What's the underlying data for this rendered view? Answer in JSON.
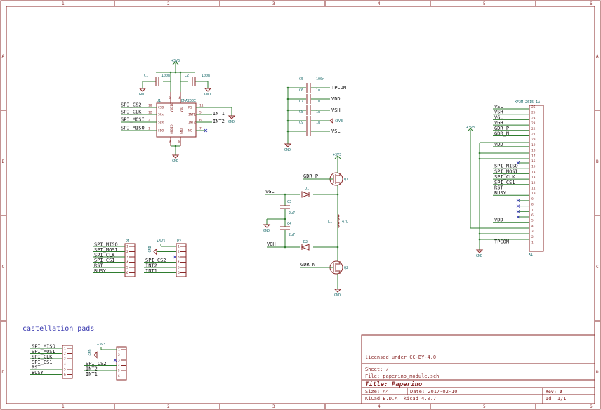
{
  "frame": {
    "cols": [
      "1",
      "2",
      "3",
      "4",
      "5",
      "6"
    ],
    "rows": [
      "A",
      "B",
      "C",
      "D"
    ]
  },
  "title_block": {
    "license": "licensed under CC-BY-4.0",
    "sheet": "Sheet: /",
    "file": "File: paperino_module.sch",
    "title": "Title: Paperino",
    "size": "Size: A4",
    "date": "Date: 2017-02-10",
    "rev": "Rev: 0",
    "tool": "KiCad E.D.A.  kicad 4.0.7",
    "id": "Id: 1/1"
  },
  "note": "castellation pads",
  "power": {
    "v33": "+3V3",
    "gnd": "GND"
  },
  "accel": {
    "ref": "U1",
    "value": "BMA250E",
    "left_pins": [
      {
        "net": "SPI_CS2",
        "num": "10",
        "name": "CSB"
      },
      {
        "net": "SPI_CLK",
        "num": "12",
        "name": "SCx"
      },
      {
        "net": "SPI_MOSI",
        "num": "2",
        "name": "SDx"
      },
      {
        "net": "SPI_MISO",
        "num": "1",
        "name": "SDO"
      }
    ],
    "right_pins": [
      {
        "net": "",
        "num": "11",
        "name": "PS"
      },
      {
        "net": "INT1",
        "num": "5",
        "name": "INT1"
      },
      {
        "net": "INT2",
        "num": "6",
        "name": "INT2"
      },
      {
        "net": "",
        "num": "7",
        "name": "NC"
      }
    ],
    "top_pins": [
      {
        "num": "3",
        "name": "VDDIO"
      },
      {
        "num": "4",
        "name": "VDD"
      }
    ],
    "bottom_pins": [
      {
        "num": "9",
        "name": "GNDIO"
      },
      {
        "num": "8",
        "name": "GND"
      }
    ],
    "caps": [
      {
        "ref": "C1",
        "val": "100n"
      },
      {
        "ref": "C2",
        "val": "100n"
      }
    ]
  },
  "cap_bank": [
    {
      "ref": "C5",
      "val": "100n",
      "net": "TPCOM"
    },
    {
      "ref": "C6",
      "val": "1u",
      "net": "VDD"
    },
    {
      "ref": "C7",
      "val": "1u",
      "net": "VSH"
    },
    {
      "ref": "C8",
      "val": "1u",
      "net": "+3V3"
    },
    {
      "ref": "C9",
      "val": "1u",
      "net": "VSL"
    }
  ],
  "boost": {
    "q1": "Q1",
    "q2": "Q2",
    "gdr_p": "GDR_P",
    "gdr_n": "GDR_N",
    "vgl": "VGL",
    "vgh": "VGH",
    "d1": "D1",
    "d2": "D2",
    "c3": {
      "ref": "C3",
      "val": "2u7"
    },
    "c4": {
      "ref": "C4",
      "val": "2u7"
    },
    "l1": {
      "ref": "L1",
      "val": "47u"
    }
  },
  "fpc": {
    "ref": "X1",
    "value": "XF2M-2615-1A",
    "pins": [
      {
        "num": "26",
        "net": "VSL"
      },
      {
        "num": "25",
        "net": "VSH"
      },
      {
        "num": "24",
        "net": "VGL"
      },
      {
        "num": "23",
        "net": "VGH"
      },
      {
        "num": "22",
        "net": "GDR_P"
      },
      {
        "num": "21",
        "net": "GDR_N"
      },
      {
        "num": "20",
        "net": ""
      },
      {
        "num": "19",
        "net": "VDD"
      },
      {
        "num": "18",
        "net": ""
      },
      {
        "num": "17",
        "net": ""
      },
      {
        "num": "16",
        "net": ""
      },
      {
        "num": "15",
        "net": "SPI_MISO"
      },
      {
        "num": "14",
        "net": "SPI_MOSI"
      },
      {
        "num": "13",
        "net": "SPI_CLK"
      },
      {
        "num": "12",
        "net": "SPI_CS1"
      },
      {
        "num": "11",
        "net": "RST"
      },
      {
        "num": "10",
        "net": "BUSY"
      },
      {
        "num": "9",
        "net": ""
      },
      {
        "num": "8",
        "net": ""
      },
      {
        "num": "7",
        "net": ""
      },
      {
        "num": "6",
        "net": ""
      },
      {
        "num": "5",
        "net": "VDD"
      },
      {
        "num": "4",
        "net": ""
      },
      {
        "num": "3",
        "net": ""
      },
      {
        "num": "2",
        "net": ""
      },
      {
        "num": "1",
        "net": "TPCOM"
      }
    ]
  },
  "headers": {
    "p1": {
      "ref": "P1",
      "nets": [
        "SPI_MISO",
        "SPI_MOSI",
        "SPI_CLK",
        "SPI_CS1",
        "RST",
        "BUSY"
      ],
      "nums": [
        "1",
        "2",
        "3",
        "4",
        "5",
        "6"
      ]
    },
    "p2": {
      "ref": "P2",
      "nets": [
        "",
        "",
        "",
        "SPI_CS2",
        "INT2",
        "INT1"
      ],
      "nums": [
        "1",
        "2",
        "3",
        "4",
        "5",
        "6"
      ]
    },
    "cast_left": {
      "nets": [
        "SPI_MISO",
        "SPI_MOSI",
        "SPI_CLK",
        "SPI_CS1",
        "RST",
        "BUSY"
      ],
      "nums": [
        "1",
        "2",
        "3",
        "4",
        "5",
        "6"
      ]
    },
    "cast_right": {
      "nets": [
        "",
        "",
        "",
        "SPI_CS2",
        "INT2",
        "INT1"
      ],
      "nums": [
        "1",
        "2",
        "3",
        "4",
        "5",
        "6"
      ]
    }
  }
}
